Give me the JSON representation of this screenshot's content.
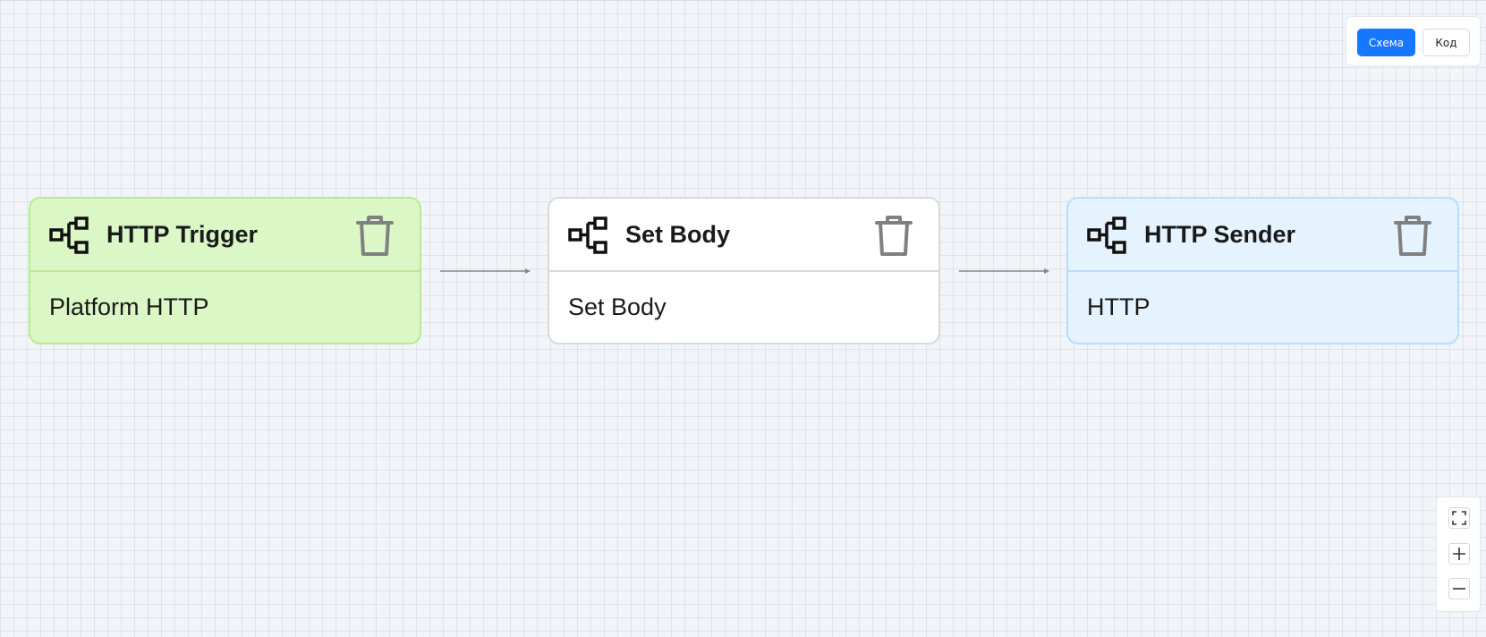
{
  "view_toggle": {
    "schema_label": "Схема",
    "code_label": "Код",
    "active": "schema"
  },
  "nodes": [
    {
      "title": "HTTP Trigger",
      "body": "Platform HTTP",
      "variant": "trigger",
      "color": "#dbf7c5",
      "border_color": "#b6ec8f",
      "icon": "flow-node-icon"
    },
    {
      "title": "Set Body",
      "body": "Set Body",
      "variant": "processor",
      "color": "#ffffff",
      "border_color": "#d9d9d9",
      "icon": "flow-node-icon"
    },
    {
      "title": "HTTP Sender",
      "body": "HTTP",
      "variant": "sender",
      "color": "#e5f3ff",
      "border_color": "#b9dcff",
      "icon": "flow-node-icon"
    }
  ],
  "zoom_controls": [
    {
      "icon": "fit-view-icon"
    },
    {
      "icon": "zoom-in-icon"
    },
    {
      "icon": "zoom-out-icon"
    }
  ],
  "colors": {
    "accent": "#1677ff",
    "canvas_background": "#f1f4f8",
    "edge": "#888888"
  }
}
